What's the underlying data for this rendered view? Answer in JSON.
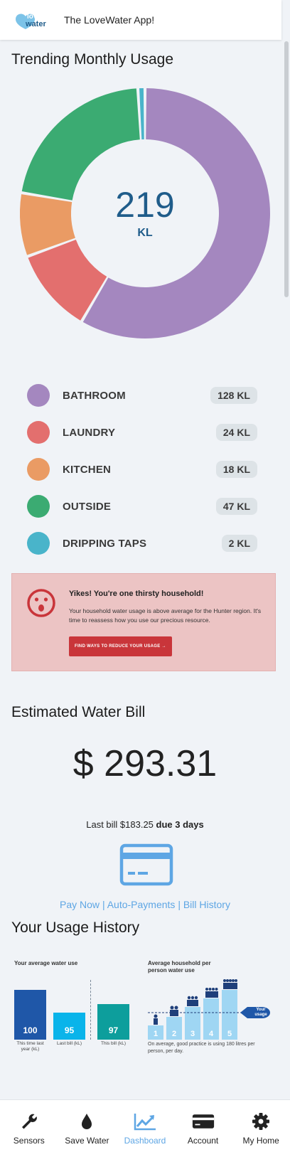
{
  "header": {
    "logo_text": "love water",
    "app_title": "The LoveWater App!"
  },
  "usage": {
    "title": "Trending Monthly Usage",
    "total_value": "219",
    "total_unit": "KL"
  },
  "chart_data": {
    "type": "pie",
    "title": "Trending Monthly Usage",
    "categories": [
      "BATHROOM",
      "LAUNDRY",
      "KITCHEN",
      "OUTSIDE",
      "DRIPPING TAPS"
    ],
    "values": [
      128,
      24,
      18,
      47,
      2
    ],
    "unit": "KL",
    "colors": [
      "#a487bf",
      "#e36f6e",
      "#ea9b64",
      "#3bab72",
      "#49b4ca"
    ]
  },
  "legend": [
    {
      "label": "BATHROOM",
      "value": "128 KL",
      "color": "#a487bf"
    },
    {
      "label": "LAUNDRY",
      "value": "24 KL",
      "color": "#e36f6e"
    },
    {
      "label": "KITCHEN",
      "value": "18 KL",
      "color": "#ea9b64"
    },
    {
      "label": "OUTSIDE",
      "value": "47 KL",
      "color": "#3bab72"
    },
    {
      "label": "DRIPPING TAPS",
      "value": "2 KL",
      "color": "#49b4ca"
    }
  ],
  "alert": {
    "title": "Yikes! You're one thirsty household!",
    "body": "Your household water usage is above average for the Hunter region. It's time to reassess how you use our precious resource.",
    "button": "FIND WAYS TO REDUCE YOUR USAGE →",
    "accent": "#c9353a"
  },
  "bill": {
    "title": "Estimated Water Bill",
    "amount": "$ 293.31",
    "last_bill_text": "Last bill $183.25",
    "due_text": "due 3 days",
    "links": [
      "Pay Now",
      "Auto-Payments",
      "Bill History"
    ],
    "link_color": "#5ea6e4"
  },
  "history": {
    "title": "Your Usage History",
    "left_title": "Your average water use",
    "bars": [
      {
        "value": "100",
        "caption": "This time last year (kL)",
        "color": "#1f57a8"
      },
      {
        "value": "95",
        "caption": "Last bill (kL)",
        "color": "#0ab4ea"
      },
      {
        "value": "97",
        "caption": "This bill (kL)",
        "color": "#0d9e9c"
      }
    ],
    "right_title": "Average household per person water use",
    "people": [
      "1",
      "2",
      "3",
      "4",
      "5"
    ],
    "your_usage_label": "Your usage",
    "note": "On average, good practice is using 180 litres per person, per day."
  },
  "nav": [
    {
      "label": "Sensors",
      "icon": "wrench-icon",
      "active": false
    },
    {
      "label": "Save Water",
      "icon": "droplet-icon",
      "active": false
    },
    {
      "label": "Dashboard",
      "icon": "chart-icon",
      "active": true
    },
    {
      "label": "Account",
      "icon": "card-icon",
      "active": false
    },
    {
      "label": "My Home",
      "icon": "gear-icon",
      "active": false
    }
  ]
}
